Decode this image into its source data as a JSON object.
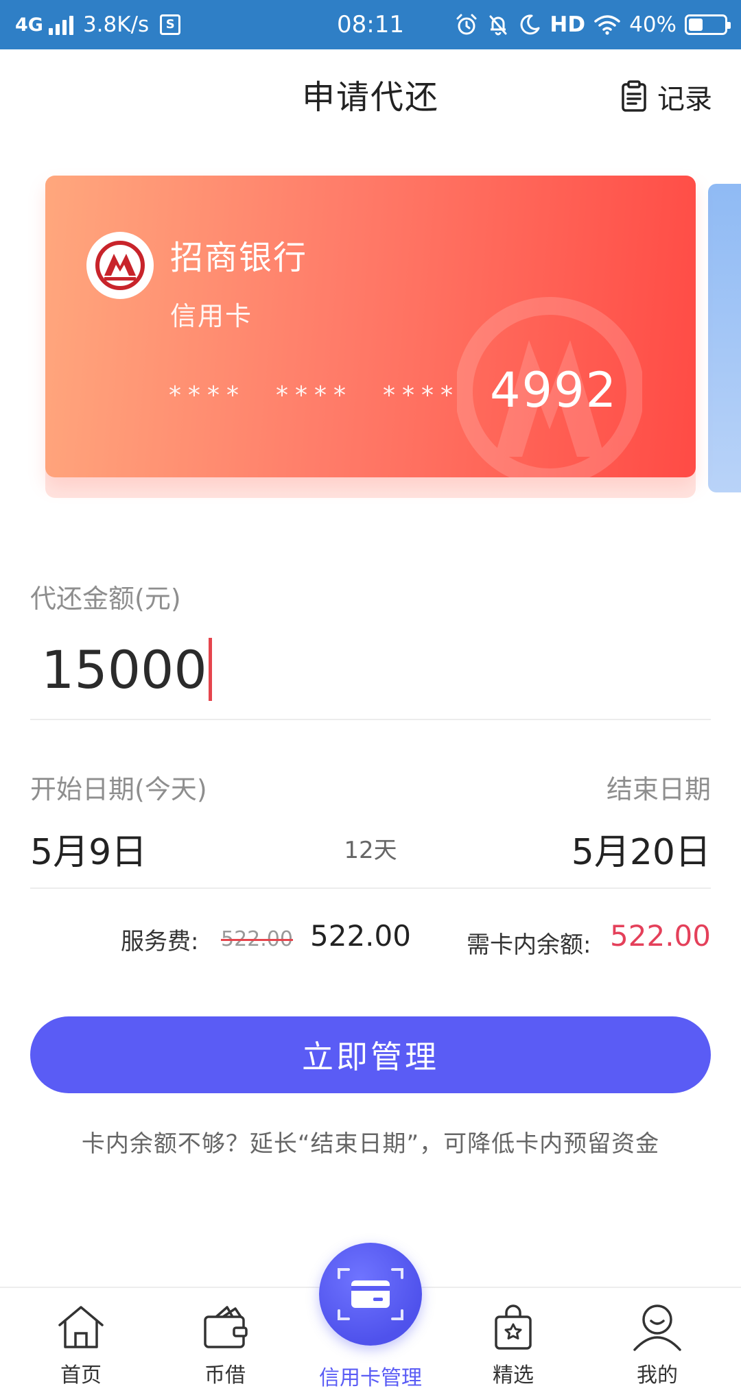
{
  "status_bar": {
    "network": "4G",
    "speed": "3.8K/s",
    "sim_icon_label": "S",
    "time": "08:11",
    "hd": "HD",
    "battery": "40%",
    "battery_level": 0.4,
    "icons": [
      "signal-icon",
      "sim-icon",
      "alarm-icon",
      "mute-bell-icon",
      "moon-icon",
      "wifi-icon",
      "battery-icon"
    ]
  },
  "header": {
    "title": "申请代还",
    "records_label": "记录",
    "records_icon": "clipboard-icon"
  },
  "card": {
    "bank_name": "招商银行",
    "card_type": "信用卡",
    "masked_groups": [
      "****",
      "****",
      "****"
    ],
    "last_digits": "4992",
    "colors": {
      "start": "#ffa77d",
      "end": "#ff4b45"
    },
    "logo_icon": "cmb-logo-icon"
  },
  "amount": {
    "label": "代还金额(元)",
    "value": "15000",
    "caret_color": "#e5454d"
  },
  "dates": {
    "start_label": "开始日期(今天)",
    "start_value": "5月9日",
    "days": "12天",
    "end_label": "结束日期",
    "end_value": "5月20日"
  },
  "fees": {
    "service_fee_label": "服务费:",
    "service_fee_original": "522.00",
    "service_fee_value": "522.00",
    "balance_label": "需卡内余额:",
    "balance_value": "522.00",
    "balance_color": "#e4405a"
  },
  "action": {
    "button_label": "立即管理",
    "button_color": "#5a5cf5",
    "hint": "卡内余额不够？延长“结束日期”，可降低卡内预留资金"
  },
  "tabbar": {
    "tabs": [
      {
        "label": "首页",
        "icon": "home-icon",
        "active": false
      },
      {
        "label": "币借",
        "icon": "wallet-icon",
        "active": false
      },
      {
        "label": "信用卡管理",
        "icon": "credit-card-scan-icon",
        "active": true
      },
      {
        "label": "精选",
        "icon": "shopping-bag-star-icon",
        "active": false
      },
      {
        "label": "我的",
        "icon": "user-icon",
        "active": false
      }
    ],
    "active_color": "#5a5cf5"
  }
}
